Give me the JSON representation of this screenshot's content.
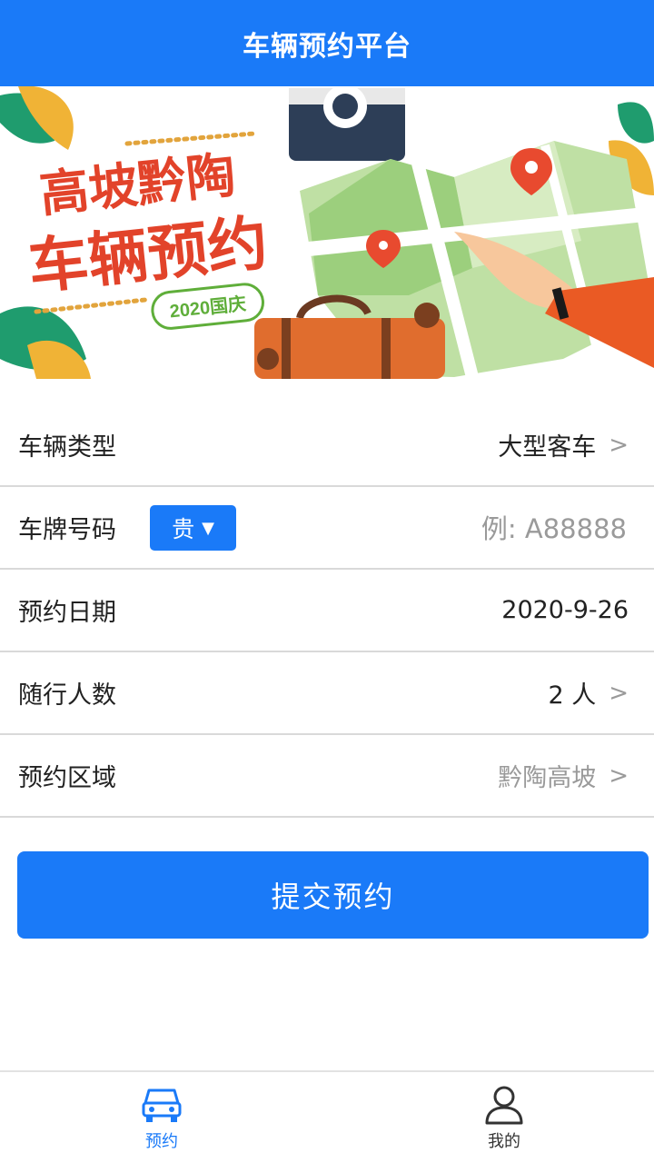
{
  "header": {
    "title": "车辆预约平台"
  },
  "banner": {
    "headline_line1": "高坡黔陶",
    "headline_line2": "车辆预约",
    "badge": "2020国庆"
  },
  "form": {
    "vehicle_type": {
      "label": "车辆类型",
      "value": "大型客车"
    },
    "plate": {
      "label": "车牌号码",
      "province": "贵",
      "placeholder": "例: A88888"
    },
    "date": {
      "label": "预约日期",
      "value": "2020-9-26"
    },
    "companions": {
      "label": "随行人数",
      "value": "2 人"
    },
    "area": {
      "label": "预约区域",
      "value": "黔陶高坡"
    },
    "chevron": ">"
  },
  "submit_label": "提交预约",
  "tabbar": {
    "tabs": [
      {
        "label": "预约",
        "icon": "car-icon",
        "active": true
      },
      {
        "label": "我的",
        "icon": "user-icon",
        "active": false
      }
    ]
  },
  "colors": {
    "primary": "#1a7af8",
    "divider": "#d9d9d9",
    "muted_text": "#9a9a9a"
  }
}
